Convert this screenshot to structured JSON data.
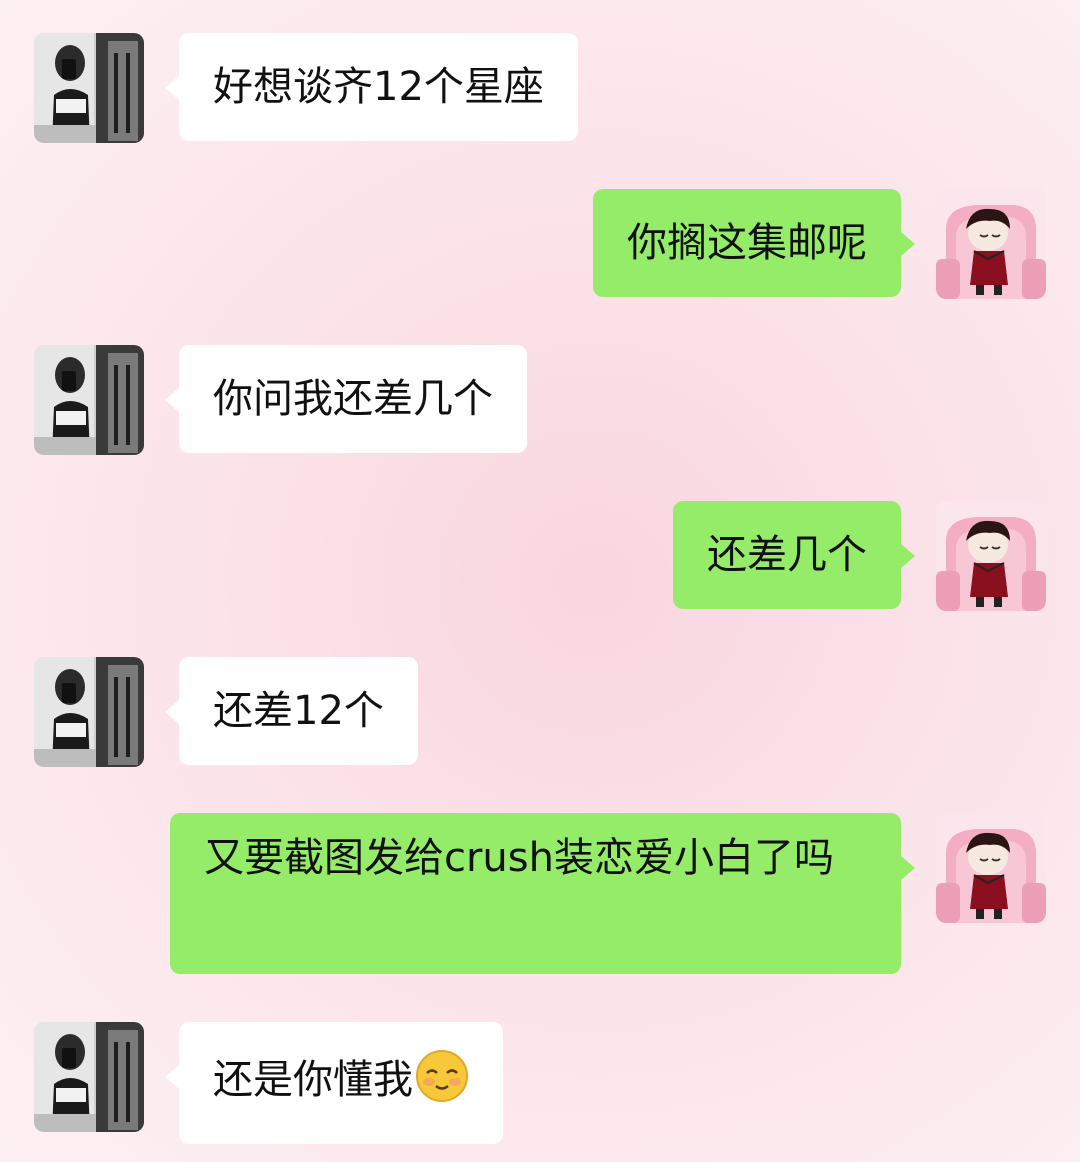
{
  "messages": [
    {
      "side": "recv",
      "text": "好想谈齐12个星座"
    },
    {
      "side": "sent",
      "text": "你搁这集邮呢"
    },
    {
      "side": "recv",
      "text": "你问我还差几个"
    },
    {
      "side": "sent",
      "text": "还差几个"
    },
    {
      "side": "recv",
      "text": "还差12个"
    },
    {
      "side": "sent",
      "text": "又要截图发给crush装恋爱小白了吗"
    },
    {
      "side": "recv",
      "text": "还是你懂我",
      "emoji": "shy-smile-emoji"
    }
  ],
  "colors": {
    "sent_bubble": "#95ec69",
    "recv_bubble": "#ffffff",
    "background": "#fbe3e9"
  },
  "icons": {
    "contact_avatar": "contact-avatar-photo",
    "my_avatar": "my-avatar-cartoon"
  }
}
